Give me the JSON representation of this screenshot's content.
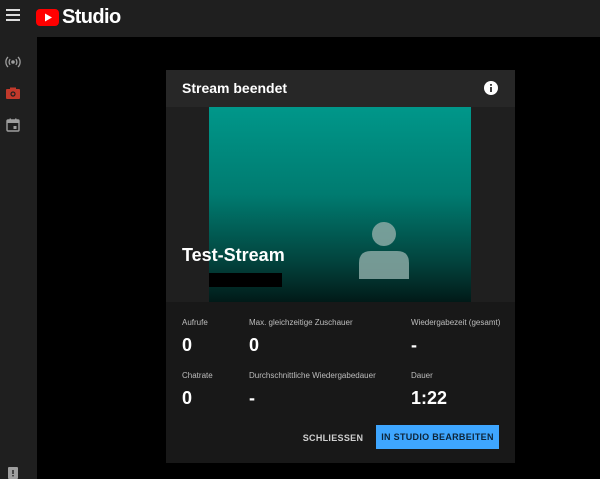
{
  "app": {
    "logo_text": "Studio",
    "brand_color": "#ff0000"
  },
  "sidebar": {
    "items": [
      {
        "icon": "live-broadcast-icon",
        "active": false
      },
      {
        "icon": "camera-icon",
        "active": true
      },
      {
        "icon": "calendar-icon",
        "active": false
      }
    ],
    "active_color": "#c1392b"
  },
  "modal": {
    "title": "Stream beendet",
    "info_icon": "info-icon",
    "stream_title": "Test-Stream",
    "stats": {
      "views": {
        "label": "Aufrufe",
        "value": "0"
      },
      "concurrent": {
        "label": "Max. gleichzeitige Zuschauer",
        "value": "0"
      },
      "watchtime": {
        "label": "Wiedergabezeit (gesamt)",
        "value": "-"
      },
      "chat": {
        "label": "Chatrate",
        "value": "0"
      },
      "avgduration": {
        "label": "Durchschnittliche Wiedergabedauer",
        "value": "-"
      },
      "duration": {
        "label": "Dauer",
        "value": "1:22"
      }
    },
    "buttons": {
      "close": "SCHLIESSEN",
      "edit": "IN STUDIO BEARBEITEN"
    },
    "accent_color": "#3ea6ff"
  }
}
